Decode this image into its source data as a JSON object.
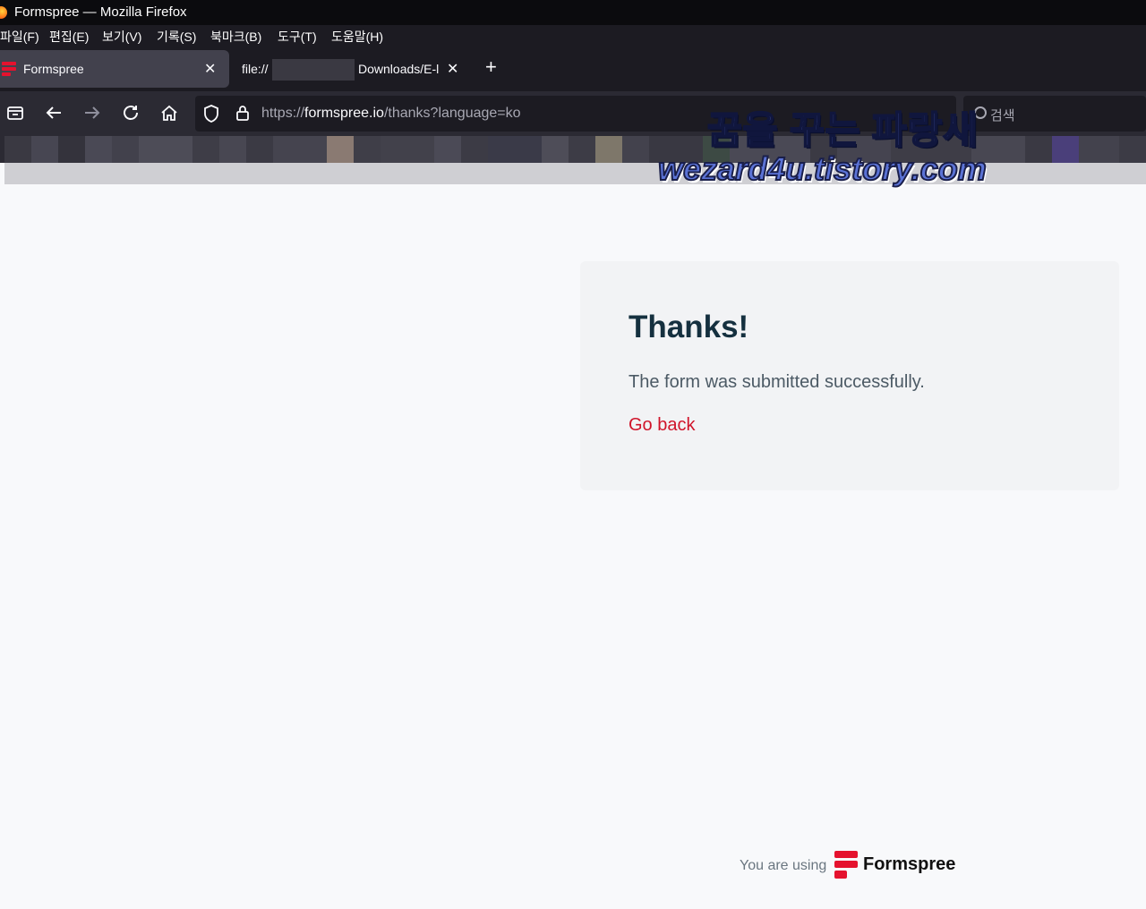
{
  "window": {
    "title": "Formspree — Mozilla Firefox"
  },
  "menu": [
    "파일(F)",
    "편집(E)",
    "보기(V)",
    "기록(S)",
    "북마크(B)",
    "도구(T)",
    "도움말(H)"
  ],
  "tabs": [
    {
      "label": "Formspree"
    },
    {
      "label_start": "file://",
      "label_end": "Downloads/E-l"
    }
  ],
  "urlbar": {
    "scheme": "https://",
    "host": "formspree.io",
    "path": "/thanks?language=ko"
  },
  "search": {
    "label": "검색"
  },
  "watermark": {
    "line1": "꿈을 꾸는 파랑새",
    "line2": "wezard4u.tistory.com"
  },
  "card": {
    "title": "Thanks!",
    "message": "The form was submitted successfully.",
    "link": "Go back"
  },
  "footer": {
    "prefix": "You are using",
    "brand": "Formspree"
  },
  "colors": {
    "accent": "#d0142a",
    "title": "#15303f",
    "brand_red": "#e5122e"
  }
}
